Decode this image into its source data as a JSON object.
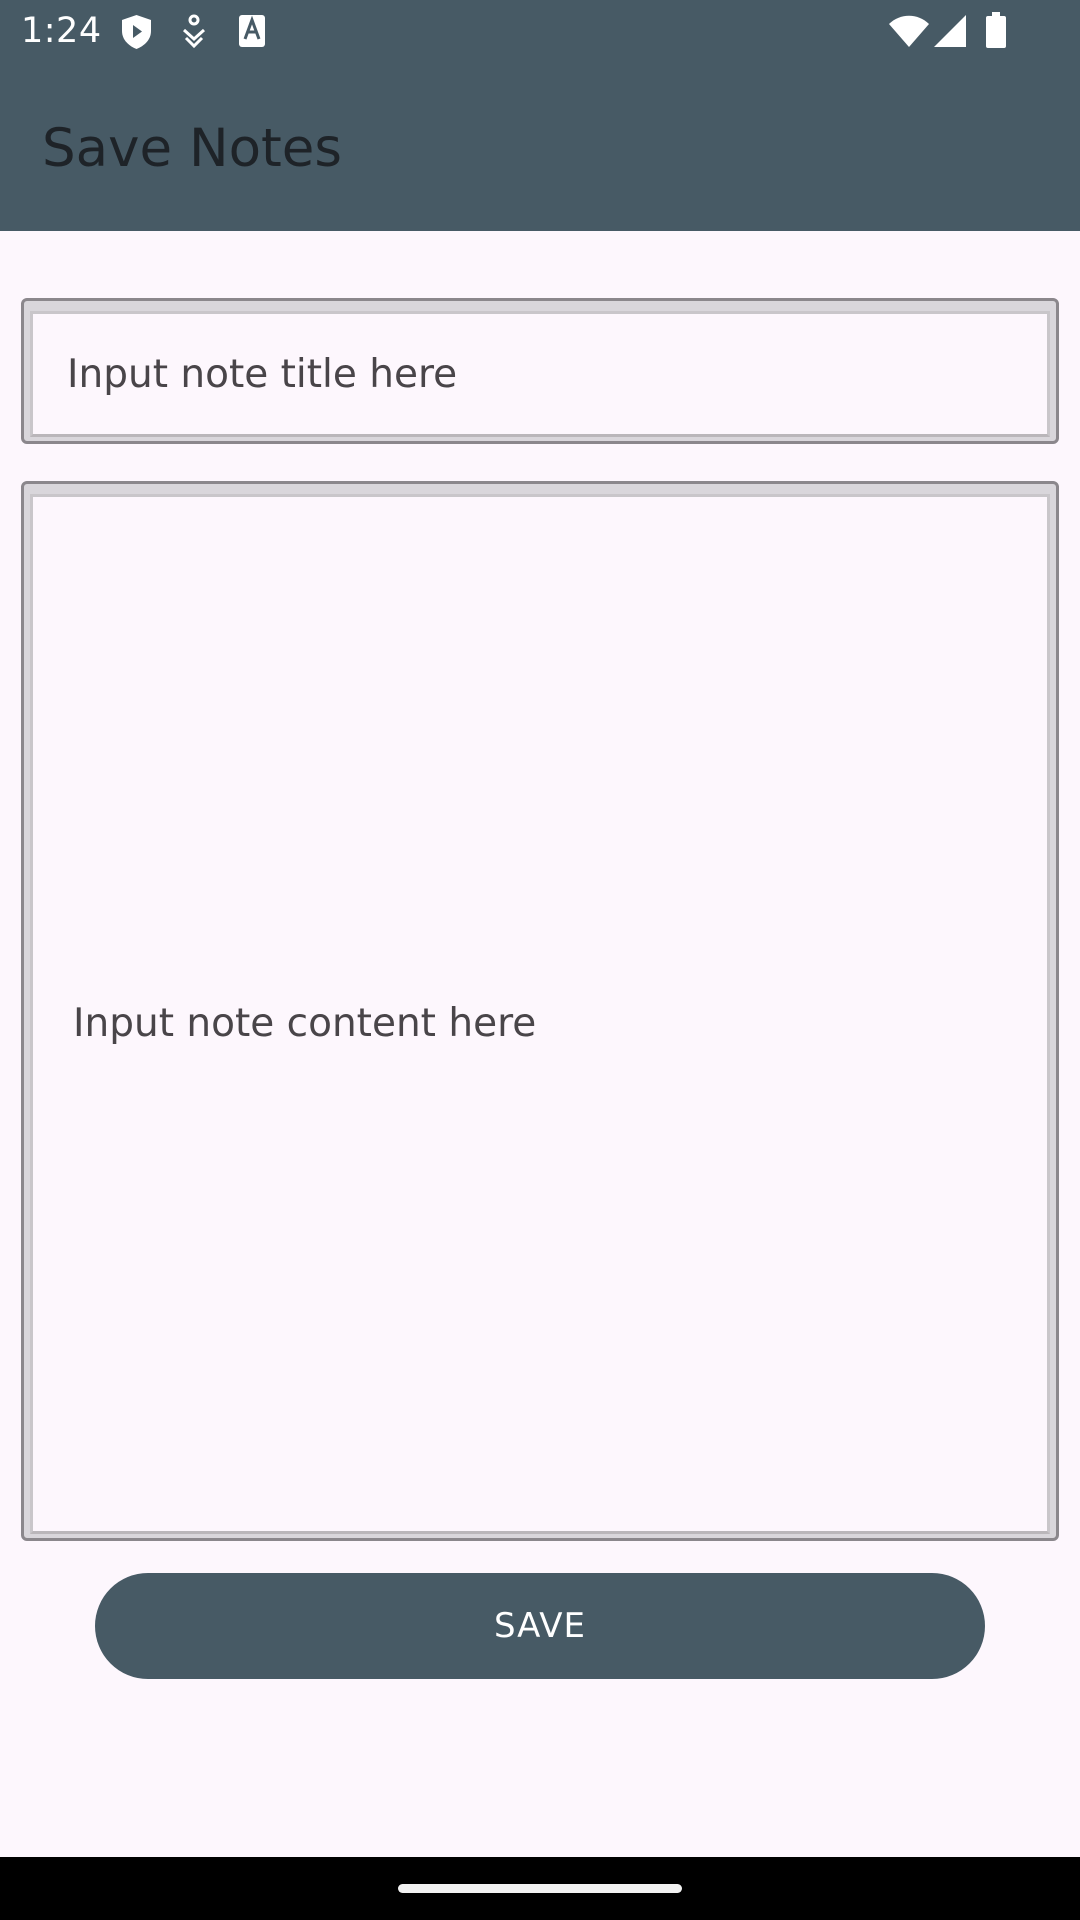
{
  "status_bar": {
    "time": "1:24",
    "left_icons": [
      "shield-play-icon",
      "download-notification-icon",
      "text-a-icon"
    ],
    "right_icons": [
      "wifi-icon",
      "cell-signal-icon",
      "battery-icon"
    ]
  },
  "app_bar": {
    "title": "Save Notes",
    "color": "#475a65"
  },
  "form": {
    "title_placeholder": "Input note title here",
    "title_value": "",
    "content_placeholder": "Input note content here",
    "content_value": ""
  },
  "actions": {
    "save_label": "SAVE"
  },
  "colors": {
    "primary": "#475a65",
    "background": "#fdf7fd"
  }
}
